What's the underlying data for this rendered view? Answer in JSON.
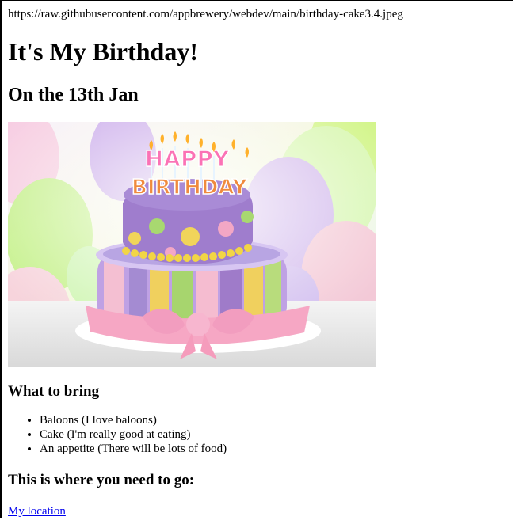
{
  "page": {
    "url_text": "https://raw.githubusercontent.com/appbrewery/webdev/main/birthday-cake3.4.jpeg",
    "title": "It's My Birthday!",
    "subtitle": "On the 13th Jan"
  },
  "cake_image": {
    "topper_line_1": "HAPPY",
    "topper_line_2": "BIRTHDAY"
  },
  "bring": {
    "heading": "What to bring",
    "items": [
      "Baloons (I love baloons)",
      "Cake (I'm really good at eating)",
      "An appetite (There will be lots of food)"
    ]
  },
  "location": {
    "heading": "This is where you need to go:",
    "link_text": "My location"
  },
  "colors": {
    "link": "#0000ee",
    "text": "#000000",
    "cake_purple": "#9d7bc3",
    "cake_pink": "#f3a7c5",
    "cake_yellow": "#f1d45a",
    "cake_green": "#a8d870"
  }
}
